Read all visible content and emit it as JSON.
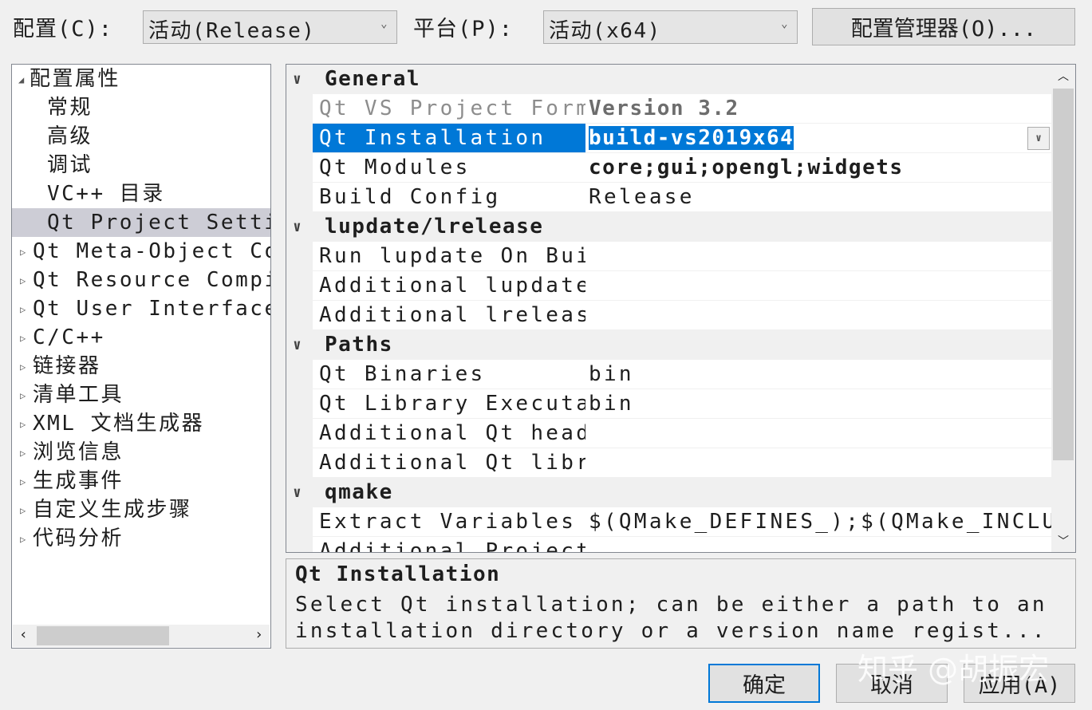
{
  "toolbar": {
    "config_label": "配置(C):",
    "config_value": "活动(Release)",
    "platform_label": "平台(P):",
    "platform_value": "活动(x64)",
    "config_manager": "配置管理器(O)..."
  },
  "tree": {
    "items": [
      {
        "label": "配置属性",
        "expander": "expanded",
        "indent": 0
      },
      {
        "label": "常规",
        "expander": "none",
        "indent": 1
      },
      {
        "label": "高级",
        "expander": "none",
        "indent": 1
      },
      {
        "label": "调试",
        "expander": "none",
        "indent": 1
      },
      {
        "label": "VC++ 目录",
        "expander": "none",
        "indent": 1
      },
      {
        "label": "Qt Project Settings",
        "expander": "none",
        "indent": 1,
        "selected": true
      },
      {
        "label": "Qt Meta-Object Compiler",
        "expander": "collapsed",
        "indent": 1
      },
      {
        "label": "Qt Resource Compiler",
        "expander": "collapsed",
        "indent": 1
      },
      {
        "label": "Qt User Interface Compiler",
        "expander": "collapsed",
        "indent": 1
      },
      {
        "label": "C/C++",
        "expander": "collapsed",
        "indent": 1
      },
      {
        "label": "链接器",
        "expander": "collapsed",
        "indent": 1
      },
      {
        "label": "清单工具",
        "expander": "collapsed",
        "indent": 1
      },
      {
        "label": "XML 文档生成器",
        "expander": "collapsed",
        "indent": 1
      },
      {
        "label": "浏览信息",
        "expander": "collapsed",
        "indent": 1
      },
      {
        "label": "生成事件",
        "expander": "collapsed",
        "indent": 1
      },
      {
        "label": "自定义生成步骤",
        "expander": "collapsed",
        "indent": 1
      },
      {
        "label": "代码分析",
        "expander": "collapsed",
        "indent": 1
      }
    ]
  },
  "grid": {
    "rows": [
      {
        "type": "header",
        "name": "General"
      },
      {
        "name": "Qt VS Project Format Version",
        "value": "Version 3.2",
        "disabled": true,
        "bold": true
      },
      {
        "name": "Qt Installation",
        "value": "build-vs2019x64",
        "selected": true,
        "bold": true,
        "dropdown": true
      },
      {
        "name": "Qt Modules",
        "value": "core;gui;opengl;widgets",
        "bold": true
      },
      {
        "name": "Build Config",
        "value": "Release"
      },
      {
        "type": "header",
        "name": "lupdate/lrelease"
      },
      {
        "name": "Run lupdate On Build",
        "value": ""
      },
      {
        "name": "Additional lupdate Options",
        "value": ""
      },
      {
        "name": "Additional lrelease Options",
        "value": ""
      },
      {
        "type": "header",
        "name": "Paths"
      },
      {
        "name": "Qt Binaries",
        "value": "bin"
      },
      {
        "name": "Qt Library Executables",
        "value": "bin"
      },
      {
        "name": "Additional Qt header search paths",
        "value": ""
      },
      {
        "name": "Additional Qt library search paths",
        "value": ""
      },
      {
        "type": "header",
        "name": "qmake"
      },
      {
        "name": "Extract Variables",
        "value": "$(QMake_DEFINES_);$(QMake_INCLUDEPATH_)"
      },
      {
        "name": "Additional Project Settings",
        "value": ""
      }
    ]
  },
  "description": {
    "title": "Qt Installation",
    "text1": "Select Qt installation; can be either a path to an",
    "text2": "installation directory or a version name regist..."
  },
  "buttons": {
    "ok": "确定",
    "cancel": "取消",
    "apply": "应用(A)"
  },
  "watermark": "知乎 @胡振宏",
  "colors": {
    "selection": "#0078d7",
    "tree_selection": "#cdcdd6"
  }
}
